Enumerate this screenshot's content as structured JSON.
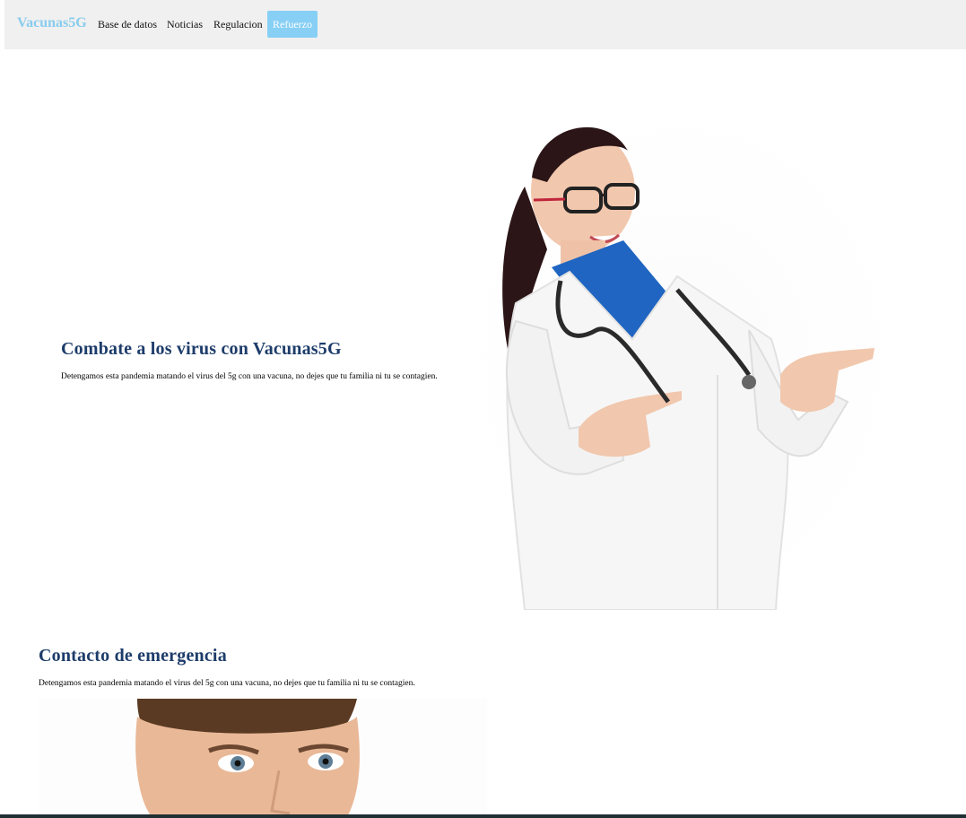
{
  "navbar": {
    "brand": "Vacunas5G",
    "links": [
      "Base de datos",
      "Noticias",
      "Regulacion"
    ],
    "cta": "Refuerzo",
    "colors": {
      "brand": "#88ccee",
      "cta_bg": "#87cff5",
      "bar_bg": "#f0f0f0"
    }
  },
  "hero": {
    "title": "Combate a los virus con Vacunas5G",
    "subtitle": "Detengamos esta pandemia matando el virus del 5g con una vacuna, no dejes que tu familia ni tu se contagien.",
    "image": "doctor-pointing-image"
  },
  "contact": {
    "title": "Contacto de emergencia",
    "subtitle": "Detengamos esta pandemia matando el virus del 5g con una vacuna, no dejes que tu familia ni tu se contagien.",
    "image": "man-face-image"
  },
  "colors": {
    "heading": "#1d3c6a",
    "footer": "#1f3033"
  }
}
